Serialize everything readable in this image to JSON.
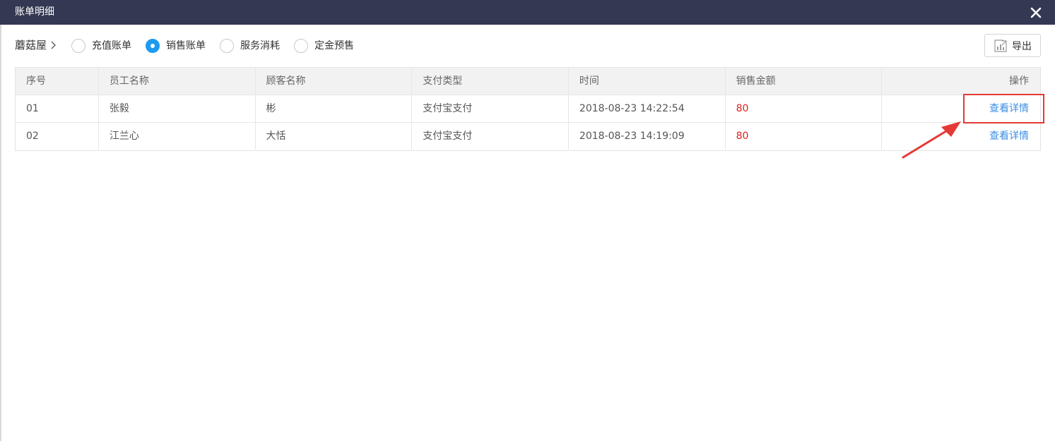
{
  "window": {
    "title": "账单明细",
    "close_icon": "close-icon",
    "header_color": "#343852"
  },
  "filter": {
    "store_name": "蘑菇屋",
    "options": [
      {
        "label": "充值账单",
        "checked": false
      },
      {
        "label": "销售账单",
        "checked": true
      },
      {
        "label": "服务消耗",
        "checked": false
      },
      {
        "label": "定金预售",
        "checked": false
      }
    ],
    "accent_color": "#1e9bf0",
    "export_label": "导出",
    "export_icon": "chart-export-icon"
  },
  "table": {
    "headers": [
      "序号",
      "员工名称",
      "顾客名称",
      "支付类型",
      "时间",
      "销售金额",
      "操作"
    ],
    "rows": [
      {
        "index": "01",
        "employee": "张毅",
        "customer": "彬",
        "pay_type": "支付宝支付",
        "time": "2018-08-23 14:22:54",
        "amount": "80",
        "action": "查看详情"
      },
      {
        "index": "02",
        "employee": "江兰心",
        "customer": "大恬",
        "pay_type": "支付宝支付",
        "time": "2018-08-23 14:19:09",
        "amount": "80",
        "action": "查看详情"
      }
    ],
    "amount_color": "#e02020",
    "link_color": "#3a8ee6"
  },
  "annotation": {
    "highlight_color": "#e53935"
  }
}
